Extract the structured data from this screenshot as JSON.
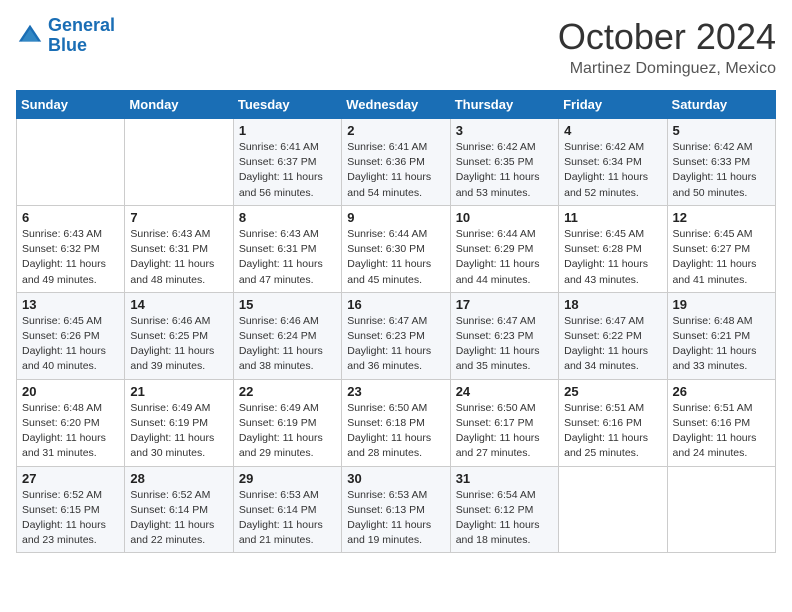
{
  "header": {
    "logo_line1": "General",
    "logo_line2": "Blue",
    "month": "October 2024",
    "location": "Martinez Dominguez, Mexico"
  },
  "weekdays": [
    "Sunday",
    "Monday",
    "Tuesday",
    "Wednesday",
    "Thursday",
    "Friday",
    "Saturday"
  ],
  "weeks": [
    [
      {
        "day": "",
        "info": ""
      },
      {
        "day": "",
        "info": ""
      },
      {
        "day": "1",
        "info": "Sunrise: 6:41 AM\nSunset: 6:37 PM\nDaylight: 11 hours and 56 minutes."
      },
      {
        "day": "2",
        "info": "Sunrise: 6:41 AM\nSunset: 6:36 PM\nDaylight: 11 hours and 54 minutes."
      },
      {
        "day": "3",
        "info": "Sunrise: 6:42 AM\nSunset: 6:35 PM\nDaylight: 11 hours and 53 minutes."
      },
      {
        "day": "4",
        "info": "Sunrise: 6:42 AM\nSunset: 6:34 PM\nDaylight: 11 hours and 52 minutes."
      },
      {
        "day": "5",
        "info": "Sunrise: 6:42 AM\nSunset: 6:33 PM\nDaylight: 11 hours and 50 minutes."
      }
    ],
    [
      {
        "day": "6",
        "info": "Sunrise: 6:43 AM\nSunset: 6:32 PM\nDaylight: 11 hours and 49 minutes."
      },
      {
        "day": "7",
        "info": "Sunrise: 6:43 AM\nSunset: 6:31 PM\nDaylight: 11 hours and 48 minutes."
      },
      {
        "day": "8",
        "info": "Sunrise: 6:43 AM\nSunset: 6:31 PM\nDaylight: 11 hours and 47 minutes."
      },
      {
        "day": "9",
        "info": "Sunrise: 6:44 AM\nSunset: 6:30 PM\nDaylight: 11 hours and 45 minutes."
      },
      {
        "day": "10",
        "info": "Sunrise: 6:44 AM\nSunset: 6:29 PM\nDaylight: 11 hours and 44 minutes."
      },
      {
        "day": "11",
        "info": "Sunrise: 6:45 AM\nSunset: 6:28 PM\nDaylight: 11 hours and 43 minutes."
      },
      {
        "day": "12",
        "info": "Sunrise: 6:45 AM\nSunset: 6:27 PM\nDaylight: 11 hours and 41 minutes."
      }
    ],
    [
      {
        "day": "13",
        "info": "Sunrise: 6:45 AM\nSunset: 6:26 PM\nDaylight: 11 hours and 40 minutes."
      },
      {
        "day": "14",
        "info": "Sunrise: 6:46 AM\nSunset: 6:25 PM\nDaylight: 11 hours and 39 minutes."
      },
      {
        "day": "15",
        "info": "Sunrise: 6:46 AM\nSunset: 6:24 PM\nDaylight: 11 hours and 38 minutes."
      },
      {
        "day": "16",
        "info": "Sunrise: 6:47 AM\nSunset: 6:23 PM\nDaylight: 11 hours and 36 minutes."
      },
      {
        "day": "17",
        "info": "Sunrise: 6:47 AM\nSunset: 6:23 PM\nDaylight: 11 hours and 35 minutes."
      },
      {
        "day": "18",
        "info": "Sunrise: 6:47 AM\nSunset: 6:22 PM\nDaylight: 11 hours and 34 minutes."
      },
      {
        "day": "19",
        "info": "Sunrise: 6:48 AM\nSunset: 6:21 PM\nDaylight: 11 hours and 33 minutes."
      }
    ],
    [
      {
        "day": "20",
        "info": "Sunrise: 6:48 AM\nSunset: 6:20 PM\nDaylight: 11 hours and 31 minutes."
      },
      {
        "day": "21",
        "info": "Sunrise: 6:49 AM\nSunset: 6:19 PM\nDaylight: 11 hours and 30 minutes."
      },
      {
        "day": "22",
        "info": "Sunrise: 6:49 AM\nSunset: 6:19 PM\nDaylight: 11 hours and 29 minutes."
      },
      {
        "day": "23",
        "info": "Sunrise: 6:50 AM\nSunset: 6:18 PM\nDaylight: 11 hours and 28 minutes."
      },
      {
        "day": "24",
        "info": "Sunrise: 6:50 AM\nSunset: 6:17 PM\nDaylight: 11 hours and 27 minutes."
      },
      {
        "day": "25",
        "info": "Sunrise: 6:51 AM\nSunset: 6:16 PM\nDaylight: 11 hours and 25 minutes."
      },
      {
        "day": "26",
        "info": "Sunrise: 6:51 AM\nSunset: 6:16 PM\nDaylight: 11 hours and 24 minutes."
      }
    ],
    [
      {
        "day": "27",
        "info": "Sunrise: 6:52 AM\nSunset: 6:15 PM\nDaylight: 11 hours and 23 minutes."
      },
      {
        "day": "28",
        "info": "Sunrise: 6:52 AM\nSunset: 6:14 PM\nDaylight: 11 hours and 22 minutes."
      },
      {
        "day": "29",
        "info": "Sunrise: 6:53 AM\nSunset: 6:14 PM\nDaylight: 11 hours and 21 minutes."
      },
      {
        "day": "30",
        "info": "Sunrise: 6:53 AM\nSunset: 6:13 PM\nDaylight: 11 hours and 19 minutes."
      },
      {
        "day": "31",
        "info": "Sunrise: 6:54 AM\nSunset: 6:12 PM\nDaylight: 11 hours and 18 minutes."
      },
      {
        "day": "",
        "info": ""
      },
      {
        "day": "",
        "info": ""
      }
    ]
  ]
}
